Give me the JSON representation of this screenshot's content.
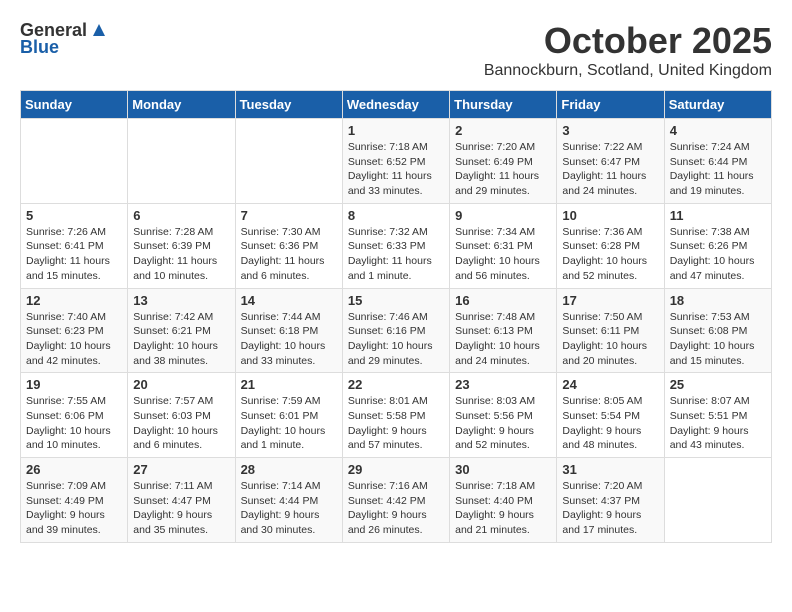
{
  "header": {
    "logo_general": "General",
    "logo_blue": "Blue",
    "month": "October 2025",
    "location": "Bannockburn, Scotland, United Kingdom"
  },
  "days_of_week": [
    "Sunday",
    "Monday",
    "Tuesday",
    "Wednesday",
    "Thursday",
    "Friday",
    "Saturday"
  ],
  "weeks": [
    [
      {
        "day": "",
        "info": ""
      },
      {
        "day": "",
        "info": ""
      },
      {
        "day": "",
        "info": ""
      },
      {
        "day": "1",
        "info": "Sunrise: 7:18 AM\nSunset: 6:52 PM\nDaylight: 11 hours and 33 minutes."
      },
      {
        "day": "2",
        "info": "Sunrise: 7:20 AM\nSunset: 6:49 PM\nDaylight: 11 hours and 29 minutes."
      },
      {
        "day": "3",
        "info": "Sunrise: 7:22 AM\nSunset: 6:47 PM\nDaylight: 11 hours and 24 minutes."
      },
      {
        "day": "4",
        "info": "Sunrise: 7:24 AM\nSunset: 6:44 PM\nDaylight: 11 hours and 19 minutes."
      }
    ],
    [
      {
        "day": "5",
        "info": "Sunrise: 7:26 AM\nSunset: 6:41 PM\nDaylight: 11 hours and 15 minutes."
      },
      {
        "day": "6",
        "info": "Sunrise: 7:28 AM\nSunset: 6:39 PM\nDaylight: 11 hours and 10 minutes."
      },
      {
        "day": "7",
        "info": "Sunrise: 7:30 AM\nSunset: 6:36 PM\nDaylight: 11 hours and 6 minutes."
      },
      {
        "day": "8",
        "info": "Sunrise: 7:32 AM\nSunset: 6:33 PM\nDaylight: 11 hours and 1 minute."
      },
      {
        "day": "9",
        "info": "Sunrise: 7:34 AM\nSunset: 6:31 PM\nDaylight: 10 hours and 56 minutes."
      },
      {
        "day": "10",
        "info": "Sunrise: 7:36 AM\nSunset: 6:28 PM\nDaylight: 10 hours and 52 minutes."
      },
      {
        "day": "11",
        "info": "Sunrise: 7:38 AM\nSunset: 6:26 PM\nDaylight: 10 hours and 47 minutes."
      }
    ],
    [
      {
        "day": "12",
        "info": "Sunrise: 7:40 AM\nSunset: 6:23 PM\nDaylight: 10 hours and 42 minutes."
      },
      {
        "day": "13",
        "info": "Sunrise: 7:42 AM\nSunset: 6:21 PM\nDaylight: 10 hours and 38 minutes."
      },
      {
        "day": "14",
        "info": "Sunrise: 7:44 AM\nSunset: 6:18 PM\nDaylight: 10 hours and 33 minutes."
      },
      {
        "day": "15",
        "info": "Sunrise: 7:46 AM\nSunset: 6:16 PM\nDaylight: 10 hours and 29 minutes."
      },
      {
        "day": "16",
        "info": "Sunrise: 7:48 AM\nSunset: 6:13 PM\nDaylight: 10 hours and 24 minutes."
      },
      {
        "day": "17",
        "info": "Sunrise: 7:50 AM\nSunset: 6:11 PM\nDaylight: 10 hours and 20 minutes."
      },
      {
        "day": "18",
        "info": "Sunrise: 7:53 AM\nSunset: 6:08 PM\nDaylight: 10 hours and 15 minutes."
      }
    ],
    [
      {
        "day": "19",
        "info": "Sunrise: 7:55 AM\nSunset: 6:06 PM\nDaylight: 10 hours and 10 minutes."
      },
      {
        "day": "20",
        "info": "Sunrise: 7:57 AM\nSunset: 6:03 PM\nDaylight: 10 hours and 6 minutes."
      },
      {
        "day": "21",
        "info": "Sunrise: 7:59 AM\nSunset: 6:01 PM\nDaylight: 10 hours and 1 minute."
      },
      {
        "day": "22",
        "info": "Sunrise: 8:01 AM\nSunset: 5:58 PM\nDaylight: 9 hours and 57 minutes."
      },
      {
        "day": "23",
        "info": "Sunrise: 8:03 AM\nSunset: 5:56 PM\nDaylight: 9 hours and 52 minutes."
      },
      {
        "day": "24",
        "info": "Sunrise: 8:05 AM\nSunset: 5:54 PM\nDaylight: 9 hours and 48 minutes."
      },
      {
        "day": "25",
        "info": "Sunrise: 8:07 AM\nSunset: 5:51 PM\nDaylight: 9 hours and 43 minutes."
      }
    ],
    [
      {
        "day": "26",
        "info": "Sunrise: 7:09 AM\nSunset: 4:49 PM\nDaylight: 9 hours and 39 minutes."
      },
      {
        "day": "27",
        "info": "Sunrise: 7:11 AM\nSunset: 4:47 PM\nDaylight: 9 hours and 35 minutes."
      },
      {
        "day": "28",
        "info": "Sunrise: 7:14 AM\nSunset: 4:44 PM\nDaylight: 9 hours and 30 minutes."
      },
      {
        "day": "29",
        "info": "Sunrise: 7:16 AM\nSunset: 4:42 PM\nDaylight: 9 hours and 26 minutes."
      },
      {
        "day": "30",
        "info": "Sunrise: 7:18 AM\nSunset: 4:40 PM\nDaylight: 9 hours and 21 minutes."
      },
      {
        "day": "31",
        "info": "Sunrise: 7:20 AM\nSunset: 4:37 PM\nDaylight: 9 hours and 17 minutes."
      },
      {
        "day": "",
        "info": ""
      }
    ]
  ]
}
